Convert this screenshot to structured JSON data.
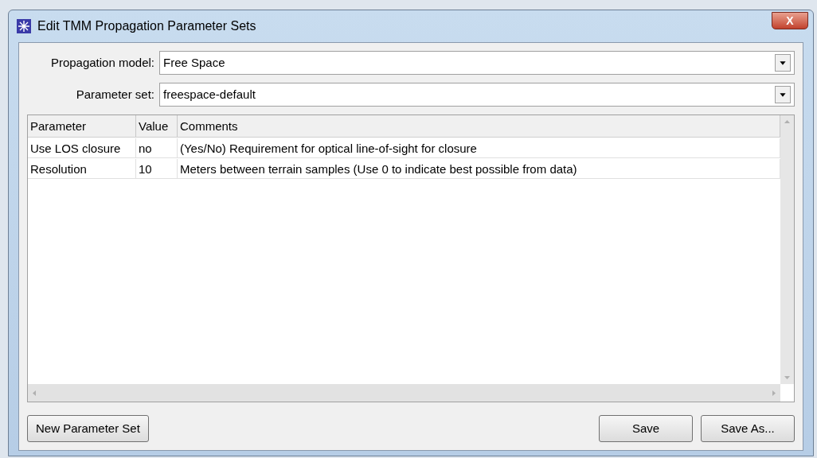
{
  "window": {
    "title": "Edit TMM Propagation Parameter Sets",
    "close": "X"
  },
  "fields": [
    {
      "label": "Propagation model:",
      "value": "Free Space"
    },
    {
      "label": "Parameter set:",
      "value": "freespace-default"
    }
  ],
  "table": {
    "columns": [
      "Parameter",
      "Value",
      "Comments"
    ],
    "rows": [
      [
        "Use LOS closure",
        "no",
        "(Yes/No) Requirement for optical line-of-sight for closure"
      ],
      [
        "Resolution",
        "10",
        "Meters between terrain samples (Use 0 to indicate best possible from data)"
      ]
    ]
  },
  "left_buttons": [
    "New Parameter Set"
  ],
  "right_buttons": [
    "Save",
    "Save As..."
  ]
}
